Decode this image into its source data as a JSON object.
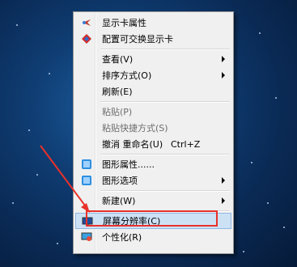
{
  "menu": {
    "items": [
      {
        "label": "显示卡属性",
        "icon": "intel-graphics-icon"
      },
      {
        "label": "配置可交换显示卡",
        "icon": "amd-diamond-icon"
      },
      {
        "label": "查看(V)",
        "submenu": true
      },
      {
        "label": "排序方式(O)",
        "submenu": true
      },
      {
        "label": "刷新(E)"
      },
      {
        "label": "粘贴(P)",
        "disabled": true
      },
      {
        "label": "粘贴快捷方式(S)",
        "disabled": true
      },
      {
        "label": "撤消 重命名(U)",
        "shortcut": "Ctrl+Z"
      },
      {
        "label": "图形属性......",
        "icon": "intel-graphics-icon"
      },
      {
        "label": "图形选项",
        "icon": "intel-graphics-icon",
        "submenu": true
      },
      {
        "label": "新建(W)",
        "submenu": true
      },
      {
        "label": "屏幕分辨率(C)",
        "icon": "display-icon",
        "highlighted": true
      },
      {
        "label": "个性化(R)",
        "icon": "personalize-icon"
      }
    ]
  },
  "annotation": {
    "color": "#e8312a"
  }
}
